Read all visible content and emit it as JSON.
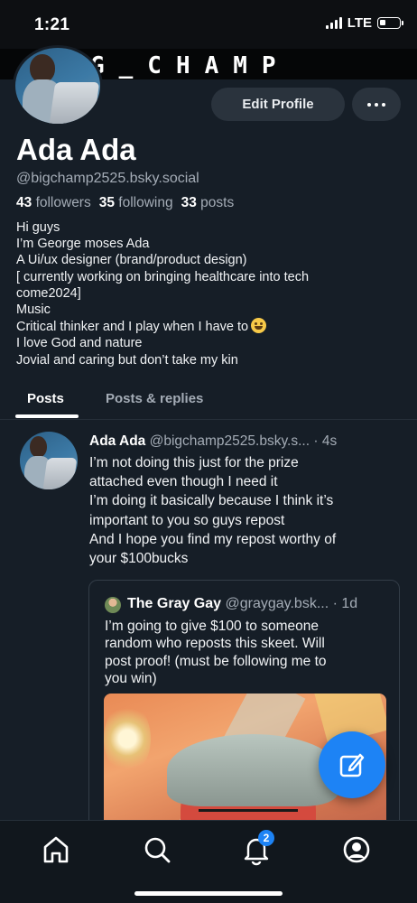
{
  "status_bar": {
    "time": "1:21",
    "network": "LTE"
  },
  "banner": {
    "text": "G_CHAMP"
  },
  "profile": {
    "edit_label": "Edit Profile",
    "display_name": "Ada Ada",
    "handle": "@bigchamp2525.bsky.social",
    "stats": {
      "followers_count": "43",
      "followers_label": "followers",
      "following_count": "35",
      "following_label": "following",
      "posts_count": "33",
      "posts_label": "posts"
    },
    "bio": [
      "Hi guys",
      "I’m George moses Ada",
      "A Ui/ux designer (brand/product design)",
      " [ currently working on bringing healthcare into tech",
      "come2024]",
      "Music",
      "Critical thinker and I play when I have to",
      "I love God and nature",
      "Jovial and caring but don’t take my kin"
    ],
    "bio_emoji": "grinning-face"
  },
  "tabs": [
    {
      "label": "Posts",
      "selected": true
    },
    {
      "label": "Posts & replies",
      "selected": false
    }
  ],
  "post": {
    "author_name": "Ada Ada",
    "author_handle": "@bigchamp2525.bsky.s...",
    "age": "4s",
    "text_lines": [
      "I’m not doing this just for the prize",
      "attached even though I need it",
      "I’m doing it basically because I think it’s",
      "important to you so guys repost",
      "And I hope you find my repost worthy of",
      "your $100bucks"
    ],
    "quote": {
      "author_name": "The Gray Gay",
      "author_handle": "@graygay.bsk...",
      "age": "1d",
      "text_lines": [
        "I’m going to give $100 to someone",
        "random who reposts this skeet. Will",
        "post proof! (must be following me to",
        "you win)"
      ]
    }
  },
  "bottom_nav": {
    "items": [
      "home-icon",
      "search-icon",
      "bell-icon",
      "profile-icon"
    ],
    "notification_badge": "2"
  },
  "colors": {
    "accent": "#1d83f5",
    "background": "#161e27",
    "muted_text": "#a4acb6"
  }
}
